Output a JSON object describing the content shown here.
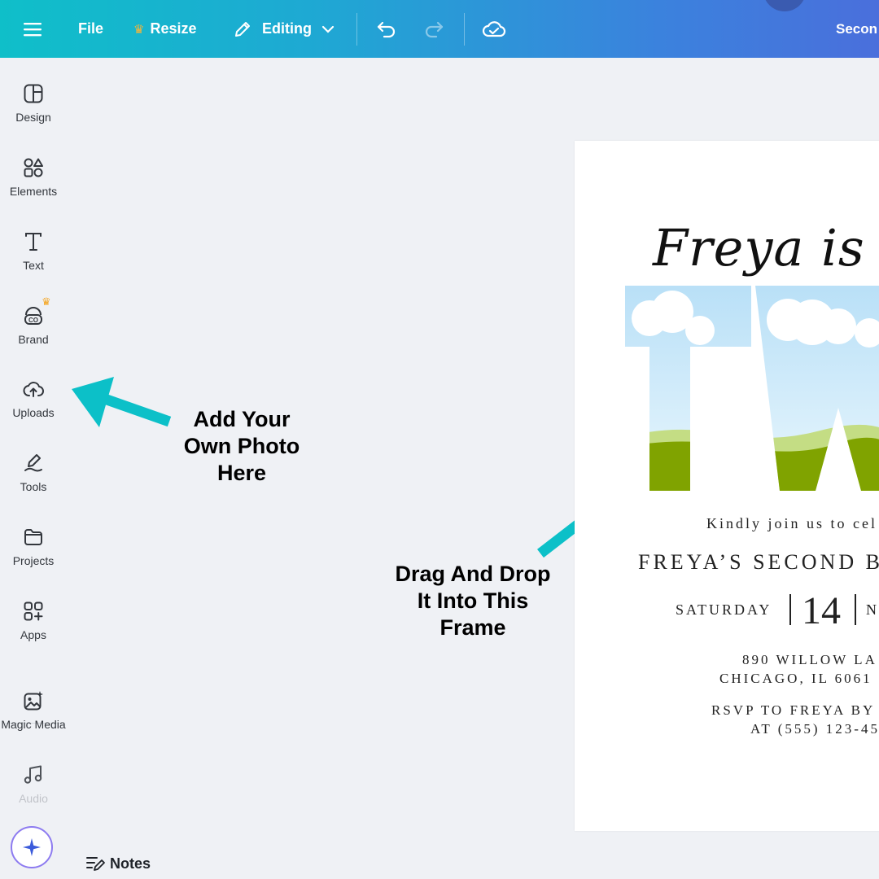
{
  "toolbar": {
    "menu_icon": "hamburger-menu-icon",
    "file_label": "File",
    "resize_label": "Resize",
    "editing_label": "Editing",
    "doc_title_partial": "Secon"
  },
  "sidebar": {
    "items": [
      {
        "label": "Design",
        "icon": "layout-icon"
      },
      {
        "label": "Elements",
        "icon": "shapes-icon"
      },
      {
        "label": "Text",
        "icon": "text-icon"
      },
      {
        "label": "Brand",
        "icon": "brand-icon"
      },
      {
        "label": "Uploads",
        "icon": "cloud-upload-icon"
      },
      {
        "label": "Tools",
        "icon": "pen-tool-icon"
      },
      {
        "label": "Projects",
        "icon": "folder-icon"
      },
      {
        "label": "Apps",
        "icon": "apps-grid-icon"
      },
      {
        "label": "Magic Media",
        "icon": "magic-image-icon"
      },
      {
        "label": "Audio",
        "icon": "music-note-icon"
      }
    ]
  },
  "notes_label": "Notes",
  "callouts": {
    "uploads": [
      "Add Your",
      "Own Photo",
      "Here"
    ],
    "frame": [
      "Drag And Drop",
      "It Into This",
      "Frame"
    ]
  },
  "invitation": {
    "title": "Freya is tu",
    "frame_letters": "TW",
    "kindly": "Kindly join us to cel",
    "event": "FREYA’S SECOND B",
    "day": "SATURDAY",
    "date": "14",
    "month": "N",
    "address_line1": "890 WILLOW LA",
    "address_line2": "CHICAGO, IL 6061",
    "rsvp_line1": "RSVP TO FREYA BY",
    "rsvp_line2": "AT (555) 123-45"
  },
  "colors": {
    "accent_arrow": "#0cc0c8",
    "crown": "#f4a623",
    "grass_dark": "#80a300",
    "grass_light": "#c4dd84",
    "sky": "#bfe3f7"
  }
}
